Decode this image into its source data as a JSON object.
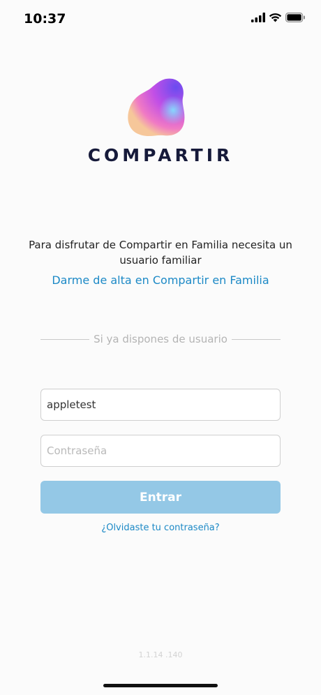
{
  "status_bar": {
    "time": "10:37",
    "icons": [
      "signal-icon",
      "wifi-icon",
      "battery-icon"
    ]
  },
  "brand": {
    "name": "COMPARTIR",
    "colors": {
      "text": "#161a3a",
      "accent": "#1c89c6",
      "button": "#94c8e6"
    }
  },
  "intro": {
    "message": "Para disfrutar de Compartir en Familia necesita un usuario familiar",
    "signup_link": "Darme de alta en Compartir en Familia"
  },
  "login": {
    "divider_text": "Si ya dispones de usuario",
    "username_value": "appletest",
    "password_placeholder": "Contraseña",
    "submit_label": "Entrar",
    "forgot_link": "¿Olvidaste tu contraseña?"
  },
  "footer": {
    "version": "1.1.14 .140"
  }
}
